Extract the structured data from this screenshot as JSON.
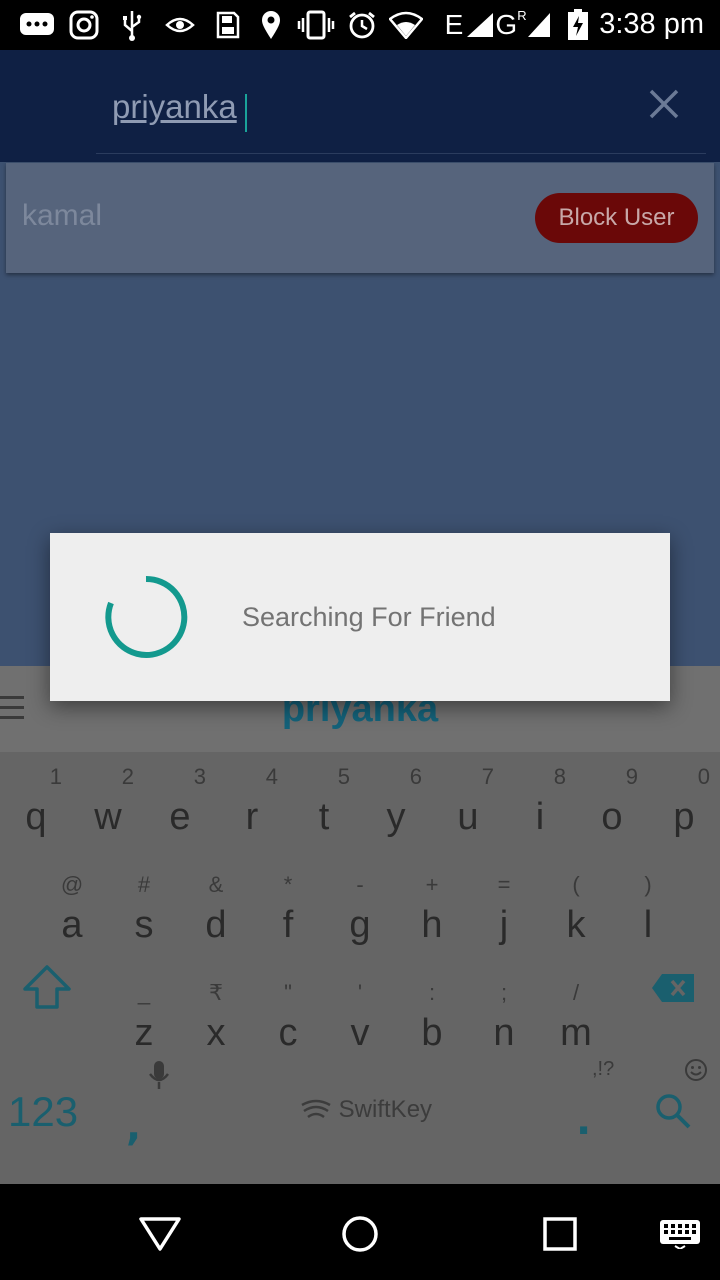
{
  "status_bar": {
    "time": "3:38 pm",
    "icons": [
      "message-icon",
      "instagram-icon",
      "usb-icon",
      "eye-icon",
      "sd-card-icon",
      "location-icon",
      "vibrate-icon",
      "alarm-icon",
      "wifi-icon",
      "signal-e-icon",
      "signal-g-icon",
      "battery-charging-icon"
    ],
    "network_e": "E",
    "network_g": "G",
    "network_r": "R"
  },
  "search": {
    "value": "priyanka",
    "clear_icon": "close-icon"
  },
  "results": [
    {
      "name": "kamal",
      "action_label": "Block User"
    }
  ],
  "dialog": {
    "message": "Searching For Friend"
  },
  "keyboard": {
    "suggestion": "priyanka",
    "row1": [
      {
        "main": "q",
        "sub": "1"
      },
      {
        "main": "w",
        "sub": "2"
      },
      {
        "main": "e",
        "sub": "3"
      },
      {
        "main": "r",
        "sub": "4"
      },
      {
        "main": "t",
        "sub": "5"
      },
      {
        "main": "y",
        "sub": "6"
      },
      {
        "main": "u",
        "sub": "7"
      },
      {
        "main": "i",
        "sub": "8"
      },
      {
        "main": "o",
        "sub": "9"
      },
      {
        "main": "p",
        "sub": "0"
      }
    ],
    "row2": [
      {
        "main": "a",
        "sub": "@"
      },
      {
        "main": "s",
        "sub": "#"
      },
      {
        "main": "d",
        "sub": "&"
      },
      {
        "main": "f",
        "sub": "*"
      },
      {
        "main": "g",
        "sub": "-"
      },
      {
        "main": "h",
        "sub": "+"
      },
      {
        "main": "j",
        "sub": "="
      },
      {
        "main": "k",
        "sub": "("
      },
      {
        "main": "l",
        "sub": ")"
      }
    ],
    "row3": [
      {
        "main": "z",
        "sub": "_"
      },
      {
        "main": "x",
        "sub": "₹"
      },
      {
        "main": "c",
        "sub": "\""
      },
      {
        "main": "v",
        "sub": "'"
      },
      {
        "main": "b",
        "sub": ":"
      },
      {
        "main": "n",
        "sub": ";"
      },
      {
        "main": "m",
        "sub": "/"
      }
    ],
    "numbers_label": "123",
    "comma": ",",
    "period": ".",
    "punct_hint": ",!?",
    "brand": "SwiftKey"
  },
  "colors": {
    "accent": "#1aa39a",
    "toolbar": "#0f2044",
    "block_button": "#6a0808"
  }
}
